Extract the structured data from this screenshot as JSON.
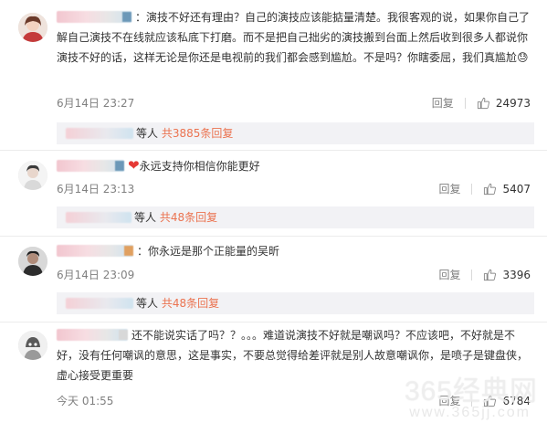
{
  "comments": [
    {
      "text": "：演技不好还有理由？自己的演技应该能掂量清楚。我很客观的说，如果你自己了解自己演技不在线就应该私底下打磨。而不是把自己拙劣的演技搬到台面上然后收到很多人都说你演技不好的话，这样无论是你还是电视前的我们都会感到尴尬。不是吗？你瞎委屈，我们真尴尬",
      "emoji": "😓",
      "date": "6月14日 23:27",
      "reply_label": "回复",
      "likes": "24973",
      "sub": {
        "prefix": "等人",
        "count": "共3885条回复"
      }
    },
    {
      "text": "永远支持你相信你能更好",
      "emoji": "❤",
      "date": "6月14日 23:13",
      "reply_label": "回复",
      "likes": "5407",
      "sub": {
        "prefix": "等人",
        "count": "共48条回复"
      }
    },
    {
      "text": "：你永远是那个正能量的吴昕",
      "date": "6月14日 23:09",
      "reply_label": "回复",
      "likes": "3396",
      "sub": {
        "prefix": "等人",
        "count": "共48条回复"
      }
    },
    {
      "text": "还不能说实话了吗？？。。。难道说演技不好就是嘲讽吗？不应该吧，不好就是不好，没有任何嘲讽的意思，这是事实，不要总觉得给差评就是别人故意嘲讽你，是喷子是键盘侠，虚心接受更重要",
      "date": "今天 01:55",
      "reply_label": "回复",
      "likes": "6784"
    }
  ],
  "watermark": {
    "main": "365经典网",
    "sub": "www.365jj.com"
  },
  "colors": {
    "accent": "#eb7350",
    "sub_bg": "#f2f2f5",
    "meta": "#808080"
  }
}
